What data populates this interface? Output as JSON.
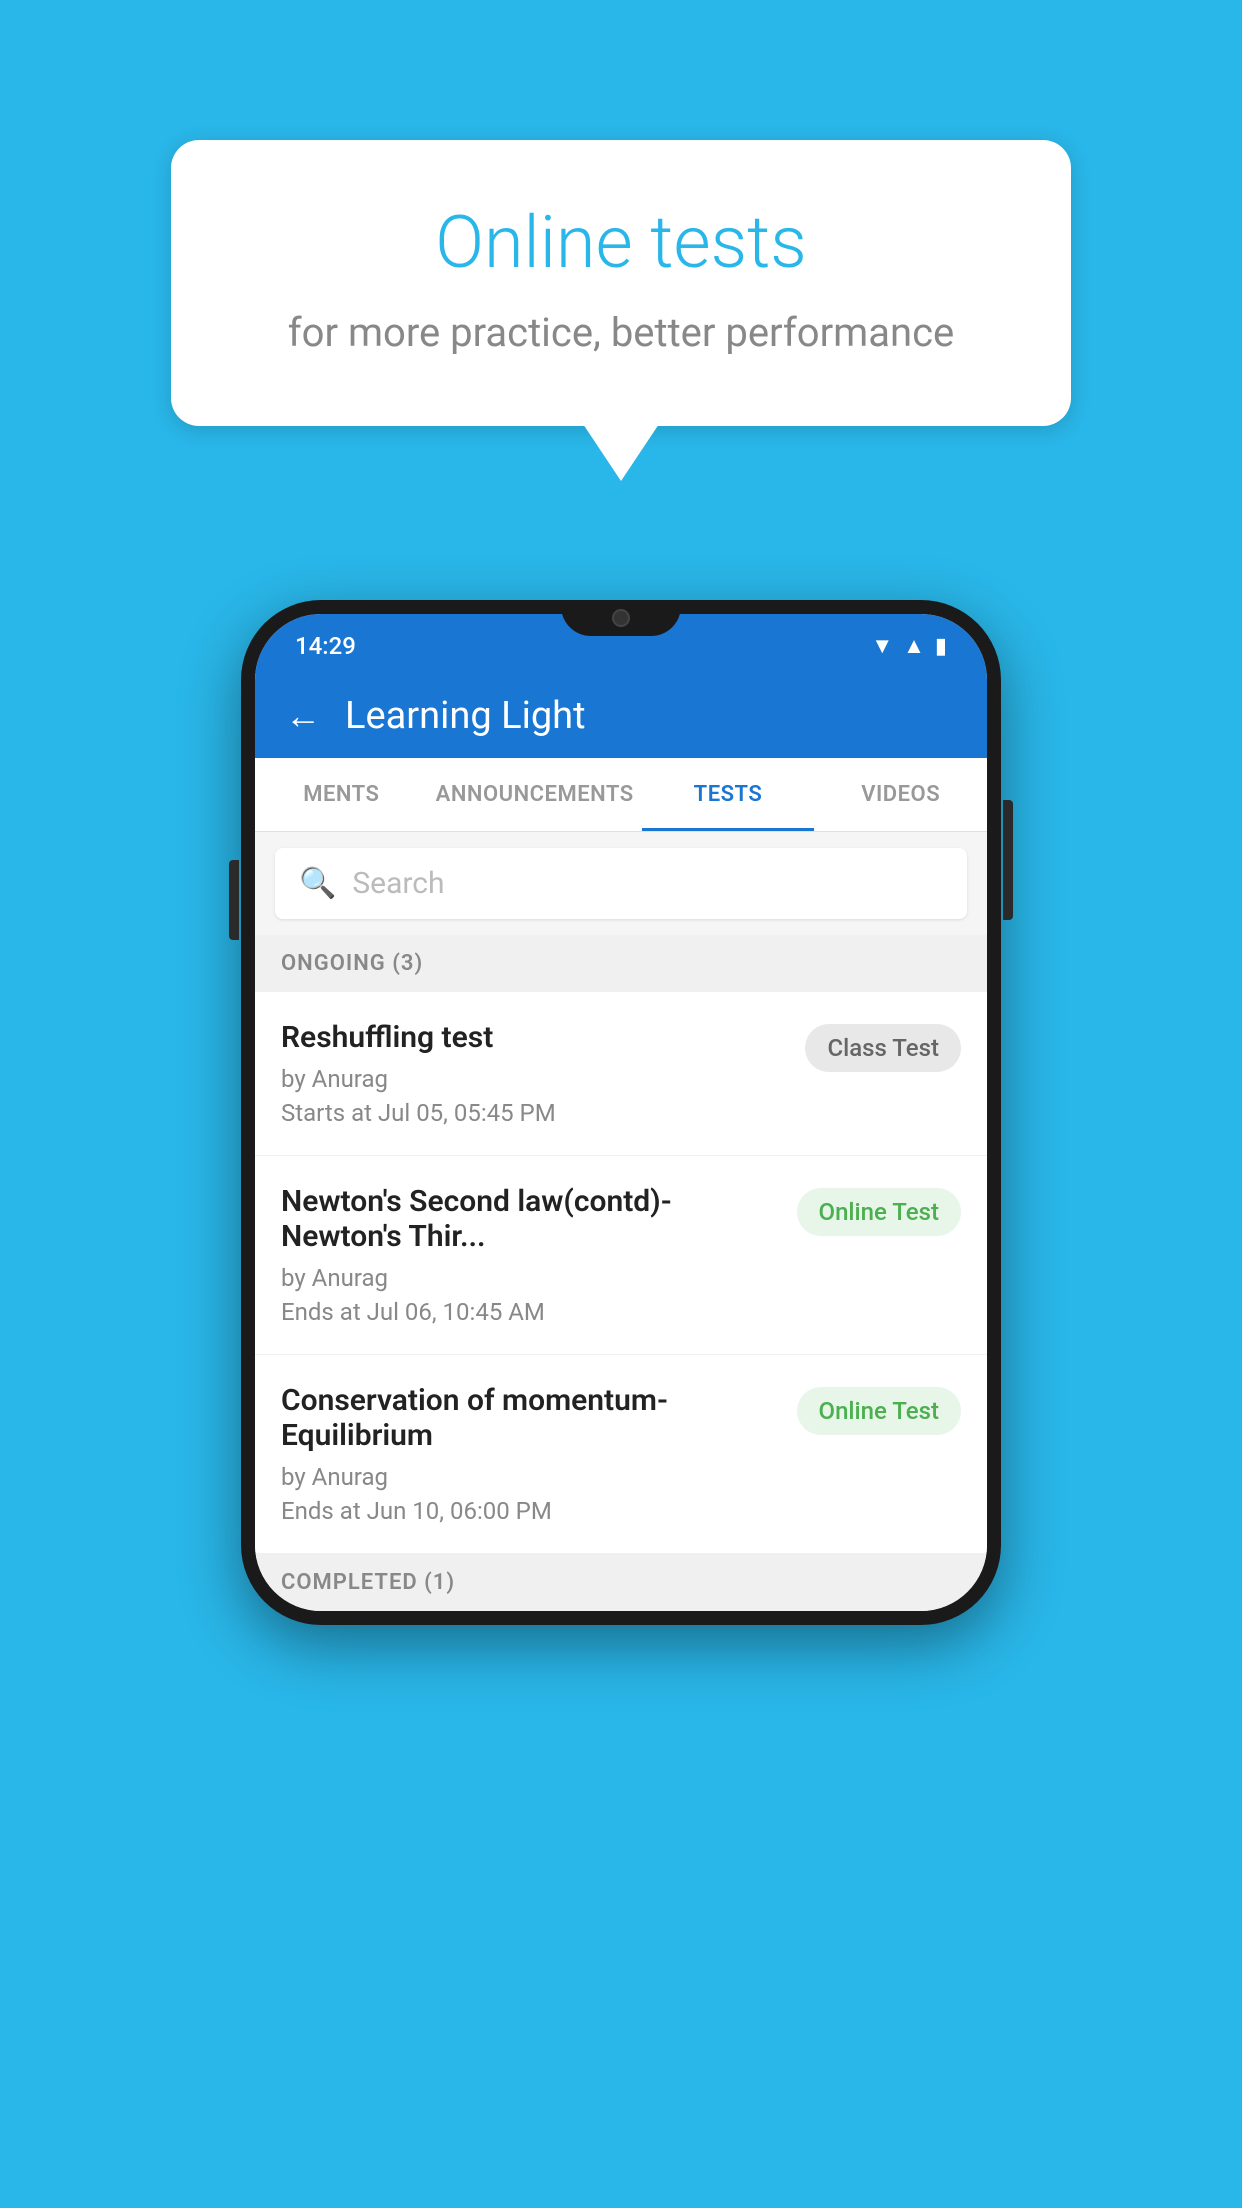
{
  "background_color": "#29B6E8",
  "bubble": {
    "title": "Online tests",
    "subtitle": "for more practice, better performance"
  },
  "phone": {
    "status_bar": {
      "time": "14:29"
    },
    "app_bar": {
      "title": "Learning Light",
      "back_label": "←"
    },
    "tabs": [
      {
        "label": "MENTS",
        "active": false
      },
      {
        "label": "ANNOUNCEMENTS",
        "active": false
      },
      {
        "label": "TESTS",
        "active": true
      },
      {
        "label": "VIDEOS",
        "active": false
      }
    ],
    "search": {
      "placeholder": "Search"
    },
    "ongoing_section": {
      "label": "ONGOING (3)"
    },
    "test_items": [
      {
        "name": "Reshuffling test",
        "author": "by Anurag",
        "date": "Starts at  Jul 05, 05:45 PM",
        "badge": "Class Test",
        "badge_type": "class"
      },
      {
        "name": "Newton's Second law(contd)-Newton's Thir...",
        "author": "by Anurag",
        "date": "Ends at  Jul 06, 10:45 AM",
        "badge": "Online Test",
        "badge_type": "online"
      },
      {
        "name": "Conservation of momentum-Equilibrium",
        "author": "by Anurag",
        "date": "Ends at  Jun 10, 06:00 PM",
        "badge": "Online Test",
        "badge_type": "online"
      }
    ],
    "completed_section": {
      "label": "COMPLETED (1)"
    }
  }
}
